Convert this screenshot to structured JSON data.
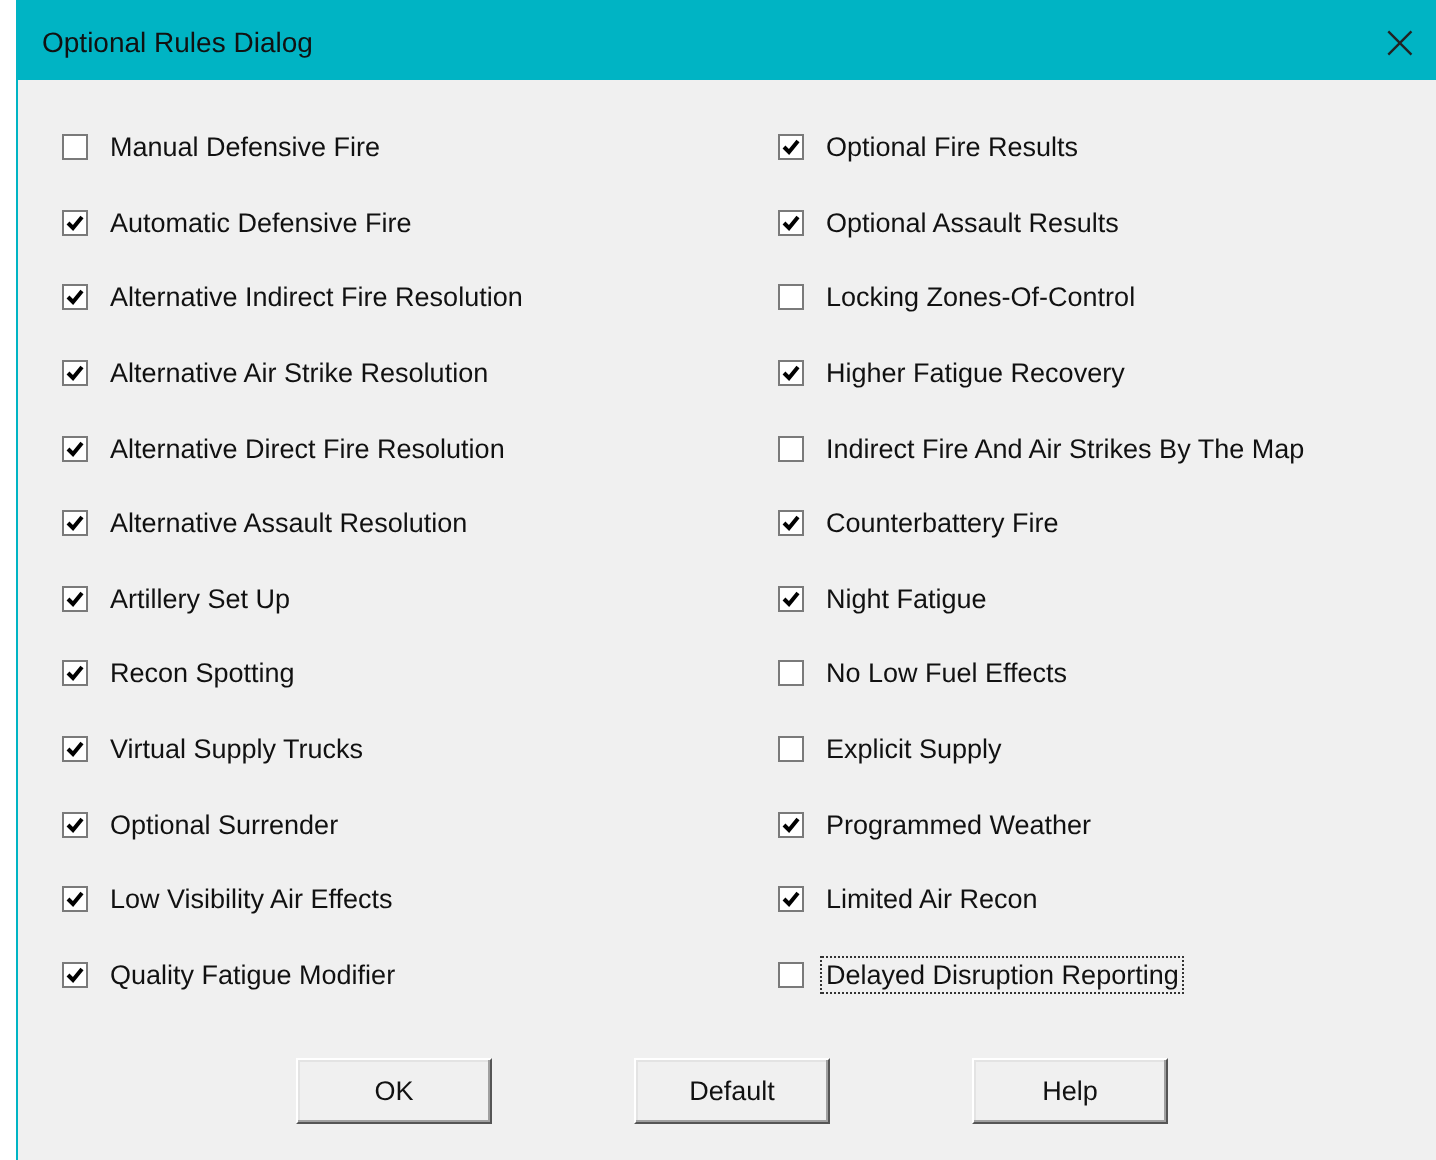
{
  "window": {
    "title": "Optional Rules Dialog",
    "close": "×"
  },
  "columns": [
    [
      {
        "label": "Manual Defensive Fire",
        "checked": false,
        "focused": false
      },
      {
        "label": "Automatic Defensive Fire",
        "checked": true,
        "focused": false
      },
      {
        "label": "Alternative Indirect Fire Resolution",
        "checked": true,
        "focused": false
      },
      {
        "label": "Alternative Air Strike Resolution",
        "checked": true,
        "focused": false
      },
      {
        "label": "Alternative Direct Fire Resolution",
        "checked": true,
        "focused": false
      },
      {
        "label": "Alternative Assault Resolution",
        "checked": true,
        "focused": false
      },
      {
        "label": "Artillery Set Up",
        "checked": true,
        "focused": false
      },
      {
        "label": "Recon Spotting",
        "checked": true,
        "focused": false
      },
      {
        "label": "Virtual Supply Trucks",
        "checked": true,
        "focused": false
      },
      {
        "label": "Optional Surrender",
        "checked": true,
        "focused": false
      },
      {
        "label": "Low Visibility Air Effects",
        "checked": true,
        "focused": false
      },
      {
        "label": "Quality Fatigue Modifier",
        "checked": true,
        "focused": false
      }
    ],
    [
      {
        "label": "Optional Fire Results",
        "checked": true,
        "focused": false
      },
      {
        "label": "Optional Assault Results",
        "checked": true,
        "focused": false
      },
      {
        "label": "Locking Zones-Of-Control",
        "checked": false,
        "focused": false
      },
      {
        "label": "Higher Fatigue Recovery",
        "checked": true,
        "focused": false
      },
      {
        "label": "Indirect Fire And Air Strikes By The Map",
        "checked": false,
        "focused": false
      },
      {
        "label": "Counterbattery Fire",
        "checked": true,
        "focused": false
      },
      {
        "label": "Night Fatigue",
        "checked": true,
        "focused": false
      },
      {
        "label": "No Low Fuel Effects",
        "checked": false,
        "focused": false
      },
      {
        "label": "Explicit Supply",
        "checked": false,
        "focused": false
      },
      {
        "label": "Programmed Weather",
        "checked": true,
        "focused": false
      },
      {
        "label": "Limited Air Recon",
        "checked": true,
        "focused": false
      },
      {
        "label": "Delayed Disruption Reporting",
        "checked": false,
        "focused": true
      }
    ]
  ],
  "buttons": [
    "OK",
    "Default",
    "Help"
  ]
}
